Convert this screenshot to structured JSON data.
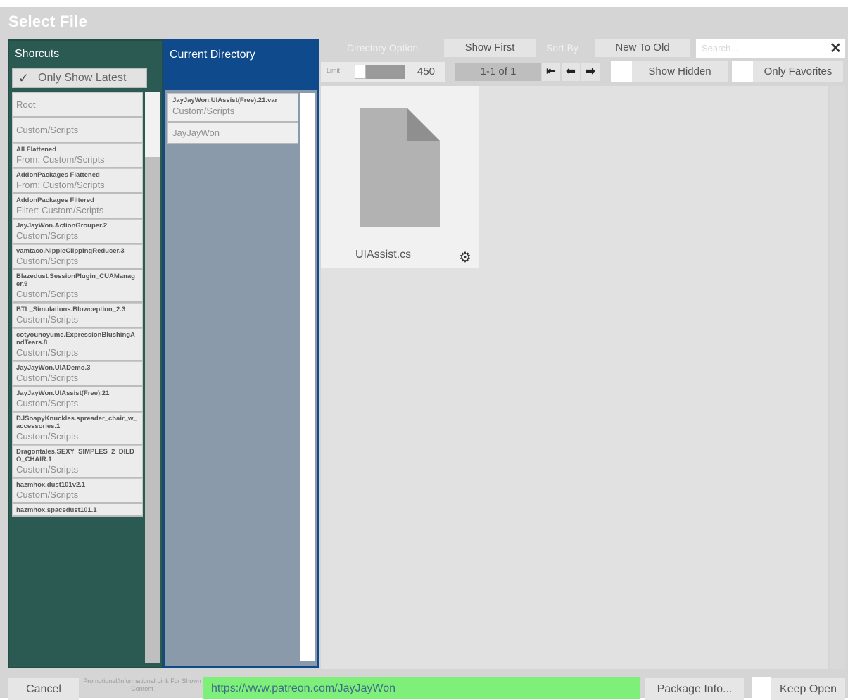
{
  "dialog": {
    "title": "Select File"
  },
  "shortcuts": {
    "title": "Shorcuts",
    "only_show_latest": {
      "label": "Only Show Latest",
      "checked": true
    },
    "items": [
      {
        "name": "Root",
        "sub": ""
      },
      {
        "name": "Custom/Scripts",
        "sub": ""
      },
      {
        "name": "All Flattened",
        "sub": "From: Custom/Scripts"
      },
      {
        "name": "AddonPackages Flattened",
        "sub": "From: Custom/Scripts"
      },
      {
        "name": "AddonPackages Filtered",
        "sub": "Filter: Custom/Scripts"
      },
      {
        "name": "JayJayWon.ActionGrouper.2",
        "sub": "Custom/Scripts"
      },
      {
        "name": "vamtaco.NippleClippingReducer.3",
        "sub": "Custom/Scripts"
      },
      {
        "name": "Blazedust.SessionPlugin_CUAManager.9",
        "sub": "Custom/Scripts"
      },
      {
        "name": "BTL_Simulations.Blowception_2.3",
        "sub": "Custom/Scripts"
      },
      {
        "name": "cotyounoyume.ExpressionBlushingAndTears.8",
        "sub": "Custom/Scripts"
      },
      {
        "name": "JayJayWon.UIADemo.3",
        "sub": "Custom/Scripts"
      },
      {
        "name": "JayJayWon.UIAssist(Free).21",
        "sub": "Custom/Scripts"
      },
      {
        "name": "DJSoapyKnuckles.spreader_chair_w_accessories.1",
        "sub": "Custom/Scripts"
      },
      {
        "name": "Dragontales.SEXY_SIMPLES_2_DILDO_CHAIR.1",
        "sub": "Custom/Scripts"
      },
      {
        "name": "hazmhox.dust101v2.1",
        "sub": "Custom/Scripts"
      },
      {
        "name": "hazmhox.spacedust101.1",
        "sub": ""
      }
    ]
  },
  "current_directory": {
    "title": "Current Directory",
    "items": [
      {
        "name": "JayJayWon.UIAssist(Free).21.var",
        "sub": "Custom/Scripts"
      },
      {
        "name": "",
        "sub": "JayJayWon"
      }
    ]
  },
  "toolbar": {
    "directory_option_label": "Directory Option",
    "show_first": "Show First",
    "sort_by_label": "Sort By",
    "sort_value": "New To Old",
    "search_placeholder": "Search...",
    "search_clear": "✕",
    "limit_label": "Limit",
    "limit_value": "450",
    "pager_text": "1-1 of 1",
    "first_page_icon": "⇤",
    "prev_page_icon": "⬅",
    "next_page_icon": "➡",
    "show_hidden": "Show Hidden",
    "only_favorites": "Only Favorites"
  },
  "files": [
    {
      "name": "UIAssist.cs",
      "icon": "document-icon"
    }
  ],
  "footer": {
    "cancel": "Cancel",
    "promo_label": "Promotional/Informational Link For Shown Content",
    "url": "https://www.patreon.com/JayJayWon",
    "package_info": "Package Info...",
    "keep_open": "Keep Open"
  },
  "colors": {
    "shortcuts_bg": "#2b5a52",
    "current_dir_header": "#0f4a8c",
    "current_dir_bg": "#8a9aab",
    "url_bg": "#7ef07a"
  }
}
